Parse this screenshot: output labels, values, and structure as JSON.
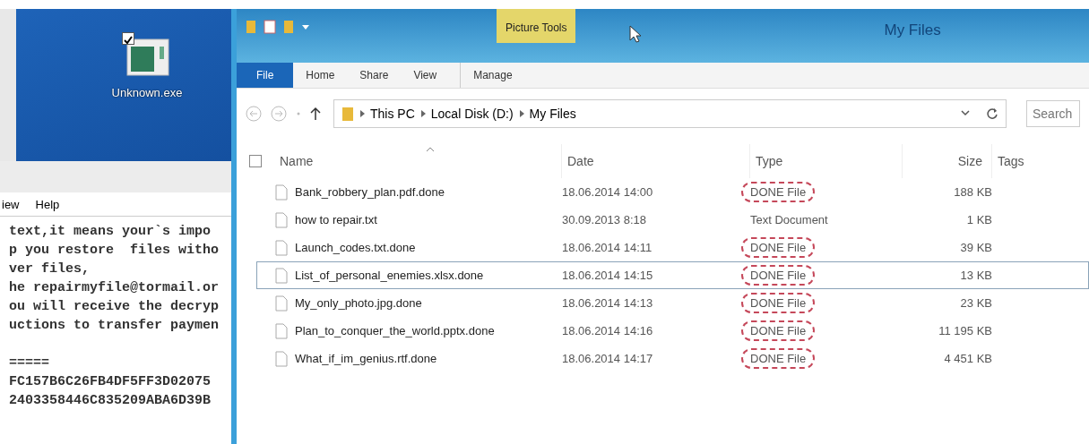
{
  "desktop": {
    "icon": {
      "label": "Unknown.exe",
      "checked": true
    }
  },
  "notepad": {
    "menu": [
      "iew",
      "Help"
    ],
    "paragraphs": [
      [
        "text,it means your`s impo",
        "p you restore  files witho",
        "ver files,",
        "he repairmyfile@tormail.or",
        "ou will receive the decryp",
        "uctions to transfer paymen"
      ],
      [
        "=====",
        "FC157B6C26FB4DF5FF3D02075",
        "2403358446C835209ABA6D39B"
      ]
    ]
  },
  "explorer": {
    "window": {
      "title": "My Files",
      "context_tab": "Picture Tools"
    },
    "ribbon_tabs": [
      {
        "label": "File",
        "selected": true
      },
      {
        "label": "Home",
        "selected": false
      },
      {
        "label": "Share",
        "selected": false
      },
      {
        "label": "View",
        "selected": false
      },
      {
        "label": "Manage",
        "selected": false
      }
    ],
    "breadcrumbs": [
      "This PC",
      "Local Disk (D:)",
      "My Files"
    ],
    "search": {
      "placeholder": "Search"
    },
    "select_all": {
      "checked": false
    },
    "columns": [
      "Name",
      "Date",
      "Type",
      "Size",
      "Tags"
    ],
    "rows": [
      {
        "name": "Bank_robbery_plan.pdf.done",
        "date": "18.06.2014 14:00",
        "type": "DONE File",
        "size": "188 KB",
        "selected": false,
        "circled": true
      },
      {
        "name": "how to repair.txt",
        "date": "30.09.2013 8:18",
        "type": "Text Document",
        "size": "1 KB",
        "selected": false,
        "circled": false
      },
      {
        "name": "Launch_codes.txt.done",
        "date": "18.06.2014 14:11",
        "type": "DONE File",
        "size": "39 KB",
        "selected": false,
        "circled": true
      },
      {
        "name": "List_of_personal_enemies.xlsx.done",
        "date": "18.06.2014 14:15",
        "type": "DONE File",
        "size": "13 KB",
        "selected": true,
        "circled": true
      },
      {
        "name": "My_only_photo.jpg.done",
        "date": "18.06.2014 14:13",
        "type": "DONE File",
        "size": "23 KB",
        "selected": false,
        "circled": true
      },
      {
        "name": "Plan_to_conquer_the_world.pptx.done",
        "date": "18.06.2014 14:16",
        "type": "DONE File",
        "size": "11 195 KB",
        "selected": false,
        "circled": true
      },
      {
        "name": "What_if_im_genius.rtf.done",
        "date": "18.06.2014 14:17",
        "type": "DONE File",
        "size": "4 451 KB",
        "selected": false,
        "circled": true
      }
    ]
  }
}
